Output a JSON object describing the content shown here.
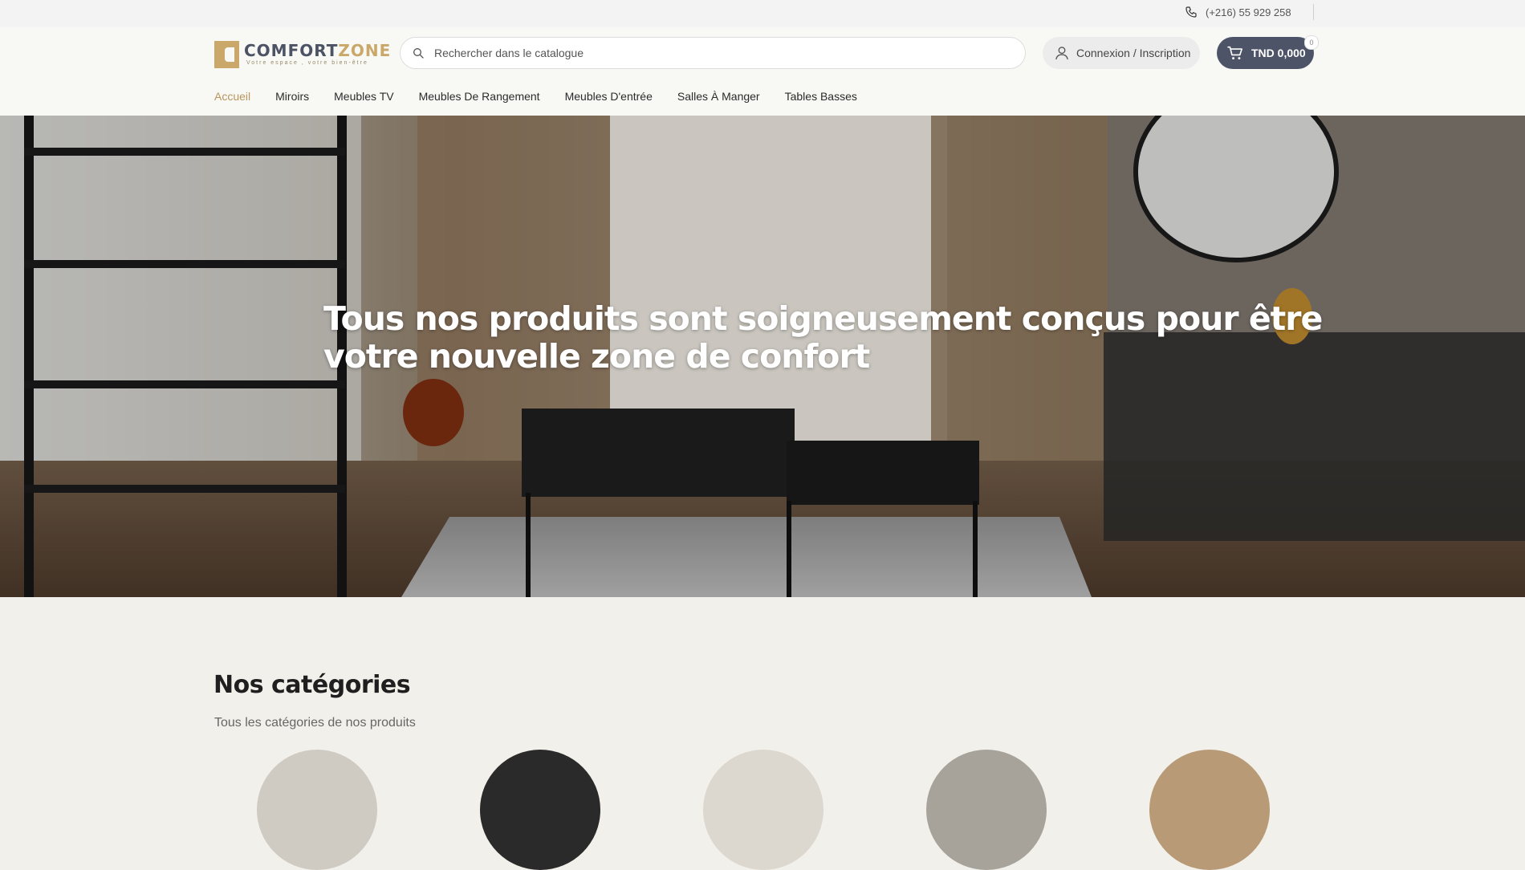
{
  "topbar": {
    "phone": "(+216) 55 929 258"
  },
  "brand": {
    "name_part1": "COMFORT",
    "name_part2": "ZONE",
    "tagline": "Votre espace , votre bien-être"
  },
  "search": {
    "placeholder": "Rechercher dans le catalogue"
  },
  "account": {
    "label": "Connexion / Inscription"
  },
  "cart": {
    "total": "TND 0,000",
    "count": "0"
  },
  "nav": {
    "items": [
      {
        "label": "Accueil",
        "active": true
      },
      {
        "label": "Miroirs"
      },
      {
        "label": "Meubles TV"
      },
      {
        "label": "Meubles De Rangement"
      },
      {
        "label": "Meubles D'entrée"
      },
      {
        "label": "Salles À Manger"
      },
      {
        "label": "Tables Basses"
      }
    ]
  },
  "hero": {
    "headline": "Tous nos produits sont soigneusement conçus pour être votre nouvelle zone de confort"
  },
  "categories": {
    "title": "Nos catégories",
    "subtitle": "Tous les catégories de nos produits"
  },
  "colors": {
    "accent": "#b9955c",
    "brand_dark": "#4d5468",
    "background": "#f2f0ea"
  }
}
